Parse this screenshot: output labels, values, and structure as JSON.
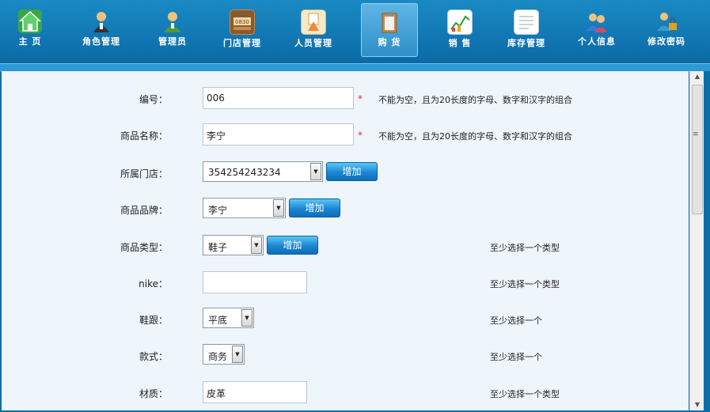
{
  "nav": {
    "items": [
      {
        "label": "主 页",
        "icon": "home-icon",
        "active": false
      },
      {
        "label": "角色管理",
        "icon": "role-user-icon",
        "active": false
      },
      {
        "label": "管理员",
        "icon": "admin-user-icon",
        "active": false
      },
      {
        "label": "门店管理",
        "icon": "store-icon",
        "active": false
      },
      {
        "label": "人员管理",
        "icon": "staff-folder-icon",
        "active": false
      },
      {
        "label": "购 货",
        "icon": "purchase-clipboard-icon",
        "active": true
      },
      {
        "label": "销 售",
        "icon": "sales-chart-icon",
        "active": false
      },
      {
        "label": "库存管理",
        "icon": "inventory-doc-icon",
        "active": false
      },
      {
        "label": "个人信息",
        "icon": "people-icon",
        "active": false
      },
      {
        "label": "修改密码",
        "icon": "password-lock-icon",
        "active": false
      }
    ]
  },
  "form": {
    "code": {
      "label": "编号：",
      "value": "006",
      "required": "*",
      "hint": "不能为空，且为20长度的字母、数字和汉字的组合"
    },
    "name": {
      "label": "商品名称：",
      "value": "李宁",
      "required": "*",
      "hint": "不能为空，且为20长度的字母、数字和汉字的组合"
    },
    "store": {
      "label": "所属门店：",
      "value": "354254243234",
      "add": "增加"
    },
    "brand": {
      "label": "商品品牌：",
      "value": "李宁",
      "add": "增加"
    },
    "type": {
      "label": "商品类型：",
      "value": "鞋子",
      "add": "增加",
      "hint": "至少选择一个类型"
    },
    "nike": {
      "label": "nike：",
      "value": "",
      "hint": "至少选择一个类型"
    },
    "heel": {
      "label": "鞋跟：",
      "value": "平底",
      "hint": "至少选择一个"
    },
    "style": {
      "label": "款式：",
      "value": "商务",
      "hint": "至少选择一个"
    },
    "material": {
      "label": "材质：",
      "value": "皮革",
      "hint": "至少选择一个类型"
    }
  },
  "scrollbar": {
    "up": "▲",
    "down": "▼",
    "grip": "≡"
  },
  "colors": {
    "accent": "#1a86d2",
    "required": "#e03030",
    "nav_bg": "#0b6aa6"
  }
}
